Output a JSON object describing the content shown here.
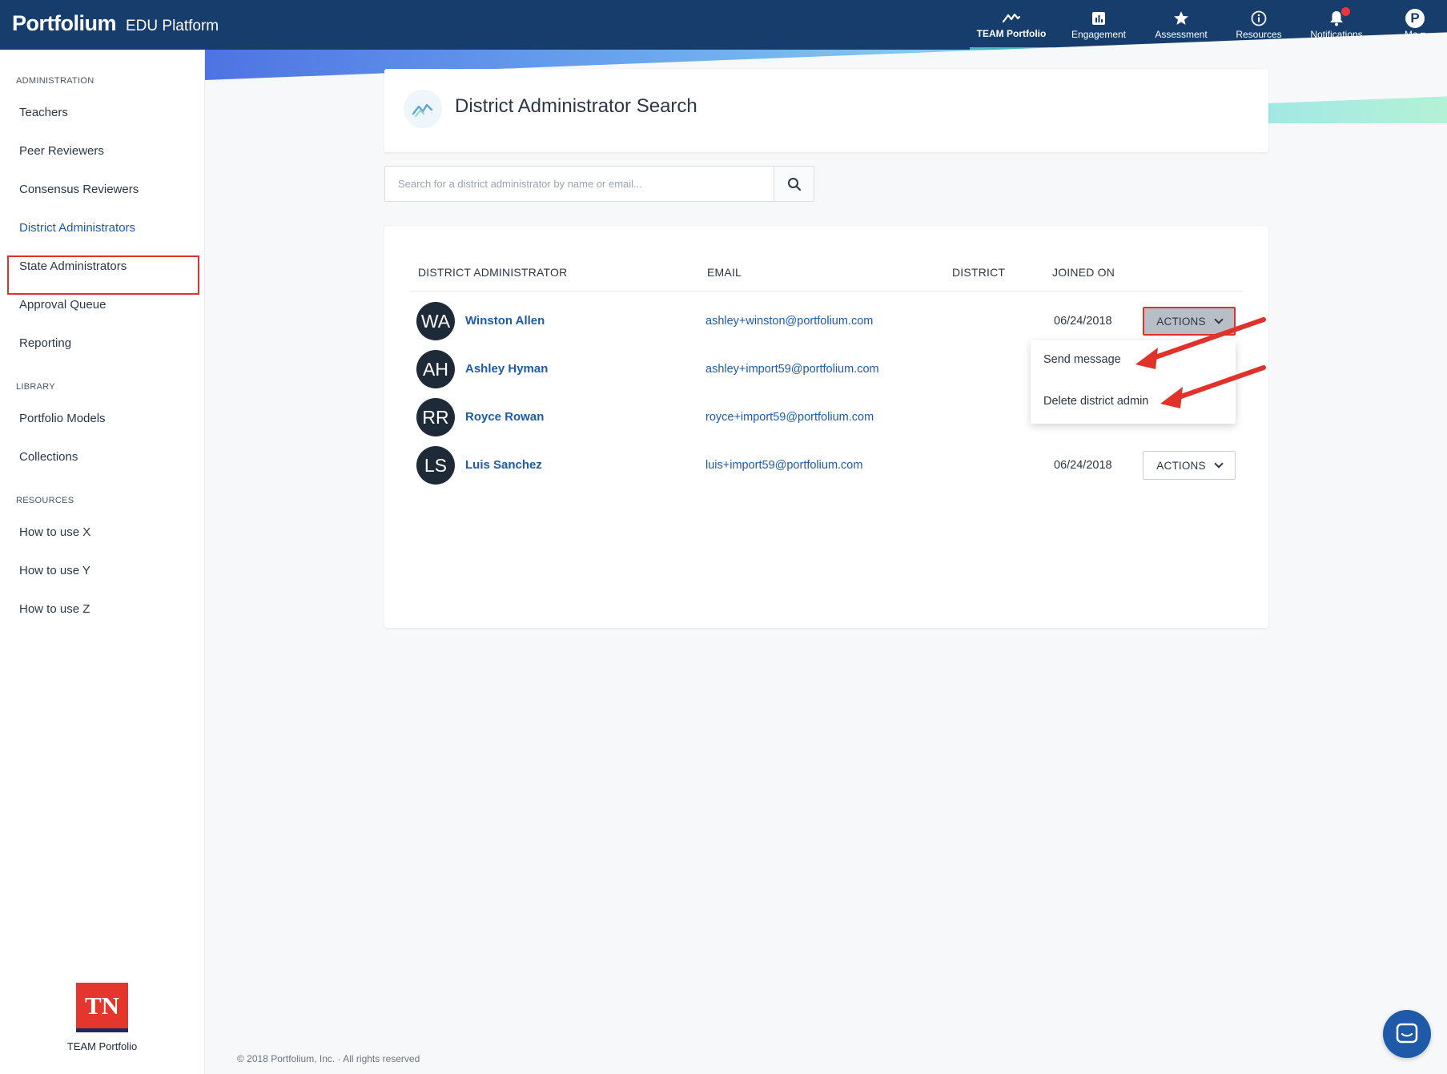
{
  "header": {
    "logo": "Portfolium",
    "platform": "EDU Platform",
    "nav": [
      {
        "label": "TEAM Portfolio",
        "icon": "team-portfolio-icon",
        "active": true
      },
      {
        "label": "Engagement",
        "icon": "bar-chart-icon"
      },
      {
        "label": "Assessment",
        "icon": "star-icon"
      },
      {
        "label": "Resources",
        "icon": "info-icon"
      },
      {
        "label": "Notifications",
        "icon": "bell-icon"
      },
      {
        "label": "Me",
        "icon": "user-avatar-icon",
        "avatar_letter": "P"
      }
    ]
  },
  "sidebar": {
    "sections": [
      {
        "title": "ADMINISTRATION",
        "items": [
          "Teachers",
          "Peer Reviewers",
          "Consensus Reviewers",
          "District Administrators",
          "State Administrators",
          "Approval Queue",
          "Reporting"
        ]
      },
      {
        "title": "LIBRARY",
        "items": [
          "Portfolio Models",
          "Collections"
        ]
      },
      {
        "title": "RESOURCES",
        "items": [
          "How to use X",
          "How to use Y",
          "How to use Z"
        ]
      }
    ],
    "active_item": "District Administrators",
    "badge": {
      "logo_text": "TN",
      "label": "TEAM Portfolio"
    }
  },
  "page": {
    "title": "District Administrator Search",
    "search_placeholder": "Search for a district administrator by name or email..."
  },
  "table": {
    "columns": [
      "DISTRICT ADMINISTRATOR",
      "EMAIL",
      "DISTRICT",
      "JOINED ON"
    ],
    "rows": [
      {
        "initials": "WA",
        "name": "Winston Allen",
        "email": "ashley+winston@portfolium.com",
        "district": "",
        "joined": "06/24/2018",
        "action": "ACTIONS"
      },
      {
        "initials": "AH",
        "name": "Ashley Hyman",
        "email": "ashley+import59@portfolium.com",
        "district": "",
        "joined": "",
        "action": ""
      },
      {
        "initials": "RR",
        "name": "Royce Rowan",
        "email": "royce+import59@portfolium.com",
        "district": "",
        "joined": "",
        "action": ""
      },
      {
        "initials": "LS",
        "name": "Luis Sanchez",
        "email": "luis+import59@portfolium.com",
        "district": "",
        "joined": "06/24/2018",
        "action": "ACTIONS"
      }
    ]
  },
  "dropdown": {
    "items": [
      "Send message",
      "Delete district admin"
    ]
  },
  "footer": "© 2018 Portfolium, Inc. · All rights reserved",
  "colors": {
    "nav_bg": "#163d6b",
    "link": "#1e5aa8",
    "highlight": "#e0322a",
    "accent": "#3fb9c6"
  }
}
